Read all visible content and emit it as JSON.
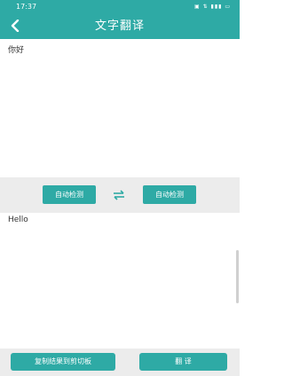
{
  "status_bar": {
    "time": "17:37",
    "icons_text": "▣ ⇅ ▮▮▮ ▭"
  },
  "app_bar": {
    "title": "文字翻译",
    "back_icon": "chevron-left-icon"
  },
  "input": {
    "text": "你好"
  },
  "language_bar": {
    "source_label": "自动检测",
    "target_label": "自动检测",
    "swap_icon": "swap-arrows-icon"
  },
  "output": {
    "text": "Hello"
  },
  "actions": {
    "copy_label": "复制结果到剪切板",
    "translate_label": "翻 译"
  },
  "colors": {
    "primary": "#2eaaa5",
    "panel": "#ececec"
  }
}
